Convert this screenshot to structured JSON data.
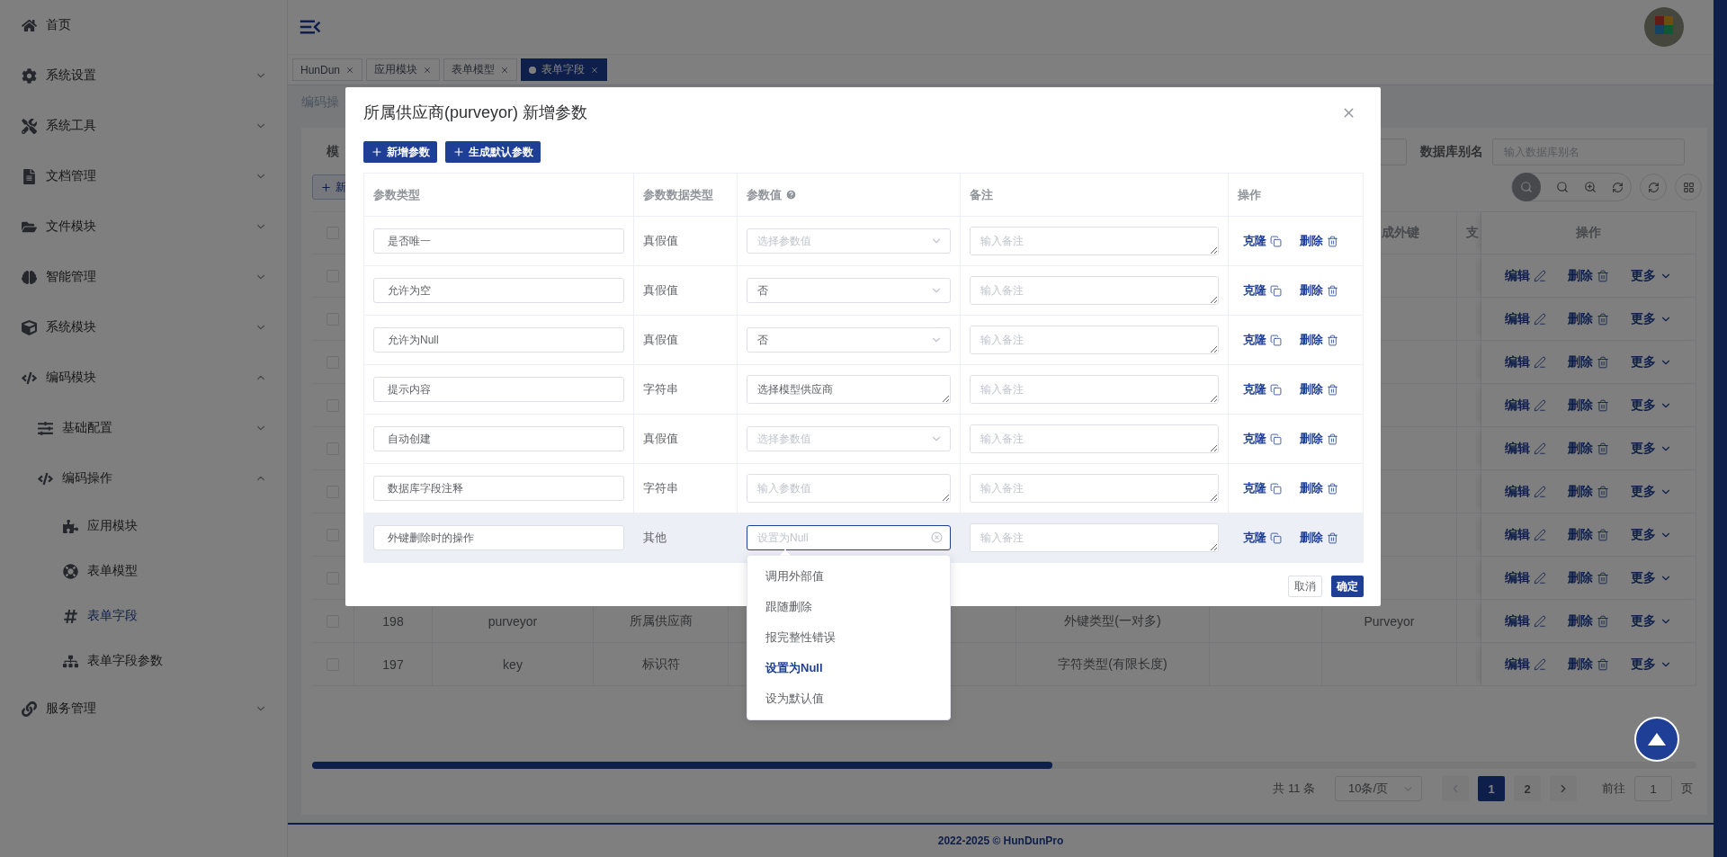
{
  "sidebar": {
    "items": [
      {
        "label": "首页",
        "selected": false
      },
      {
        "label": "系统设置",
        "selected": false,
        "expanded": false
      },
      {
        "label": "系统工具",
        "selected": false,
        "expanded": false
      },
      {
        "label": "文档管理",
        "selected": false,
        "expanded": false
      },
      {
        "label": "文件模块",
        "selected": false,
        "expanded": false
      },
      {
        "label": "智能管理",
        "selected": false,
        "expanded": false
      },
      {
        "label": "系统模块",
        "selected": false,
        "expanded": false
      },
      {
        "label": "编码模块",
        "selected": false,
        "expanded": true,
        "children": [
          {
            "label": "基础配置",
            "selected": false,
            "expanded": false
          },
          {
            "label": "编码操作",
            "selected": false,
            "expanded": true,
            "children": [
              {
                "label": "应用模块",
                "selected": false
              },
              {
                "label": "表单模型",
                "selected": false
              },
              {
                "label": "表单字段",
                "selected": true
              },
              {
                "label": "表单字段参数",
                "selected": false
              }
            ]
          }
        ]
      },
      {
        "label": "服务管理",
        "selected": false,
        "expanded": false
      }
    ]
  },
  "tabs": [
    {
      "label": "HunDun",
      "selected": false
    },
    {
      "label": "应用模块",
      "selected": false
    },
    {
      "label": "表单模型",
      "selected": false
    },
    {
      "label": "表单字段",
      "selected": true
    }
  ],
  "breadcrumb": "编码操",
  "search": {
    "cut_label": "模",
    "alias_label": "数据库别名",
    "alias_placeholder": "输入数据库别名"
  },
  "toolbar": {
    "add_button": "新"
  },
  "table": {
    "header_checked": false,
    "columns": [
      {
        "label": "成外键"
      },
      {
        "label": "支"
      },
      {
        "label": "操作"
      }
    ],
    "rows": [
      {
        "checked": false,
        "actions": [
          "编辑",
          "删除",
          "更多"
        ]
      },
      {
        "checked": false,
        "actions": [
          "编辑",
          "删除",
          "更多"
        ]
      },
      {
        "checked": false,
        "actions": [
          "编辑",
          "删除",
          "更多"
        ]
      },
      {
        "checked": false,
        "actions": [
          "编辑",
          "删除",
          "更多"
        ]
      },
      {
        "checked": false,
        "actions": [
          "编辑",
          "删除",
          "更多"
        ]
      },
      {
        "checked": false,
        "actions": [
          "编辑",
          "删除",
          "更多"
        ]
      },
      {
        "checked": false,
        "actions": [
          "编辑",
          "删除",
          "更多"
        ]
      },
      {
        "checked": false,
        "actions": [
          "编辑",
          "删除",
          "更多"
        ]
      },
      {
        "checked": false,
        "column_2": "198",
        "column_3": "purveyor",
        "column_4": "所属供应商",
        "column_6": "外键类型(一对多)",
        "column_8": "Purveyor",
        "actions": [
          "编辑",
          "删除",
          "更多"
        ]
      },
      {
        "checked": false,
        "column_2": "197",
        "column_3": "key",
        "column_4": "标识符",
        "column_6": "字符类型(有限长度)",
        "actions": [
          "编辑",
          "删除",
          "更多"
        ]
      }
    ]
  },
  "pagination": {
    "total": "共 11 条",
    "page_size": "10条/页",
    "prev_disabled": true,
    "pages": [
      {
        "label": "1",
        "selected": true
      },
      {
        "label": "2",
        "selected": false
      }
    ],
    "goto_label": "前往",
    "goto_value": "1",
    "goto_suffix": "页"
  },
  "footer": "2022-2025 © HunDunPro",
  "dialog": {
    "title": "所属供应商(purveyor) 新增参数",
    "buttons": [
      "新增参数",
      "生成默认参数"
    ],
    "columns": [
      "参数类型",
      "参数数据类型",
      "参数值",
      "备注",
      "操作"
    ],
    "rows": [
      {
        "name": "是否唯一",
        "data_type": "真假值",
        "value": {
          "kind": "select",
          "placeholder": "选择参数值",
          "focused": false
        },
        "note_placeholder": "输入备注",
        "actions": [
          "克隆",
          "删除"
        ],
        "hovered": false
      },
      {
        "name": "允许为空",
        "data_type": "真假值",
        "value": {
          "kind": "select",
          "value": "否",
          "focused": false
        },
        "note_placeholder": "输入备注",
        "actions": [
          "克隆",
          "删除"
        ],
        "hovered": false
      },
      {
        "name": "允许为Null",
        "data_type": "真假值",
        "value": {
          "kind": "select",
          "value": "否",
          "focused": false
        },
        "note_placeholder": "输入备注",
        "actions": [
          "克隆",
          "删除"
        ],
        "hovered": false
      },
      {
        "name": "提示内容",
        "data_type": "字符串",
        "value": {
          "kind": "textarea",
          "value": "选择模型供应商"
        },
        "note_placeholder": "输入备注",
        "actions": [
          "克隆",
          "删除"
        ],
        "hovered": false
      },
      {
        "name": "自动创建",
        "data_type": "真假值",
        "value": {
          "kind": "select",
          "placeholder": "选择参数值",
          "focused": false
        },
        "note_placeholder": "输入备注",
        "actions": [
          "克隆",
          "删除"
        ],
        "hovered": false
      },
      {
        "name": "数据库字段注释",
        "data_type": "字符串",
        "value": {
          "kind": "textarea",
          "placeholder": "输入参数值"
        },
        "note_placeholder": "输入备注",
        "actions": [
          "克隆",
          "删除"
        ],
        "hovered": false
      },
      {
        "name": "外键删除时的操作",
        "data_type": "其他",
        "value": {
          "kind": "select",
          "placeholder": "设置为Null",
          "focused": true,
          "options": [
            {
              "label": "调用外部值",
              "selected": false
            },
            {
              "label": "跟随删除",
              "selected": false
            },
            {
              "label": "报完整性错误",
              "selected": false
            },
            {
              "label": "设置为Null",
              "selected": true
            },
            {
              "label": "设为默认值",
              "selected": false
            }
          ]
        },
        "note_placeholder": "输入备注",
        "actions": [
          "克隆",
          "删除"
        ],
        "hovered": true
      }
    ],
    "footer_buttons": [
      "取消",
      "确定"
    ]
  }
}
